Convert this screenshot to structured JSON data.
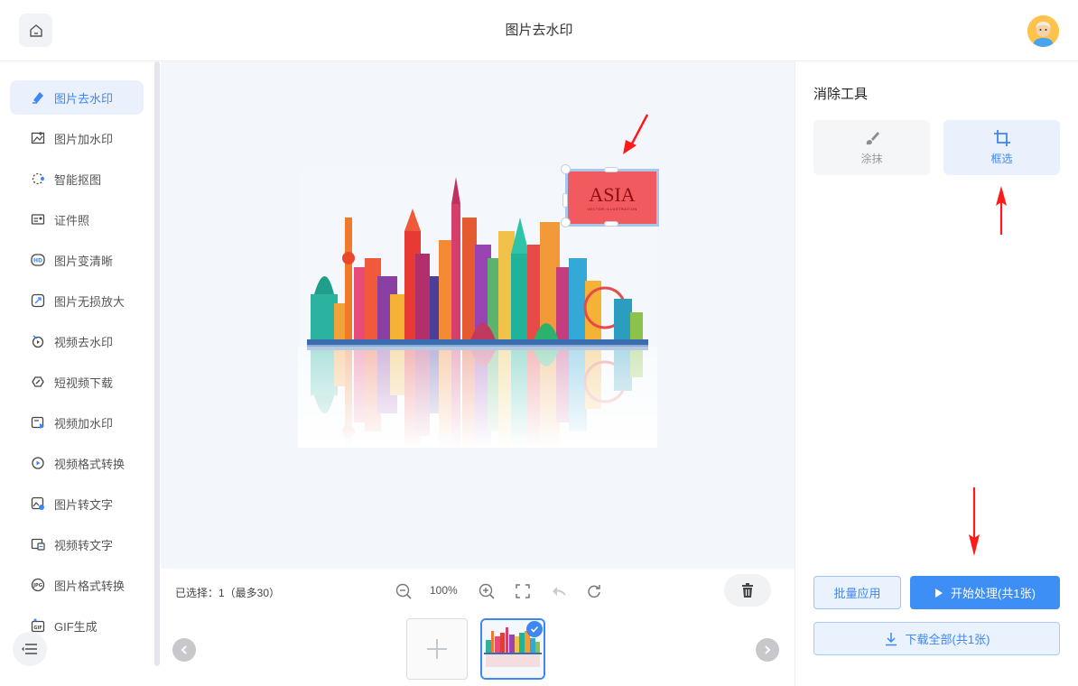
{
  "app": {
    "title": "图片去水印"
  },
  "sidebar": {
    "items": [
      {
        "label": "图片去水印",
        "icon": "eraser-icon",
        "active": true
      },
      {
        "label": "图片加水印",
        "icon": "image-add-watermark-icon"
      },
      {
        "label": "智能抠图",
        "icon": "cutout-icon"
      },
      {
        "label": "证件照",
        "icon": "id-photo-icon"
      },
      {
        "label": "图片变清晰",
        "icon": "hd-icon"
      },
      {
        "label": "图片无损放大",
        "icon": "enlarge-icon"
      },
      {
        "label": "视频去水印",
        "icon": "video-remove-watermark-icon"
      },
      {
        "label": "短视频下载",
        "icon": "link-download-icon"
      },
      {
        "label": "视频加水印",
        "icon": "video-add-watermark-icon"
      },
      {
        "label": "视频格式转换",
        "icon": "video-convert-icon"
      },
      {
        "label": "图片转文字",
        "icon": "image-to-text-icon"
      },
      {
        "label": "视频转文字",
        "icon": "video-to-text-icon"
      },
      {
        "label": "图片格式转换",
        "icon": "jpg-convert-icon"
      },
      {
        "label": "GIF生成",
        "icon": "gif-icon"
      }
    ]
  },
  "canvas": {
    "watermark_text": "ASIA",
    "watermark_subtext": "VECTOR ILLUSTRATION"
  },
  "toolbar": {
    "selection_info": "已选择：1（最多30）",
    "zoom": "100%"
  },
  "panel": {
    "title": "消除工具",
    "tools": [
      {
        "label": "涂抹",
        "icon": "brush-icon"
      },
      {
        "label": "框选",
        "icon": "crop-icon",
        "active": true
      }
    ],
    "batch_label": "批量应用",
    "start_label": "开始处理(共1张)",
    "download_label": "下载全部(共1张)"
  },
  "colors": {
    "accent": "#3d86f3",
    "arrow": "#ff1a1a",
    "watermark": "#f15a5f"
  }
}
